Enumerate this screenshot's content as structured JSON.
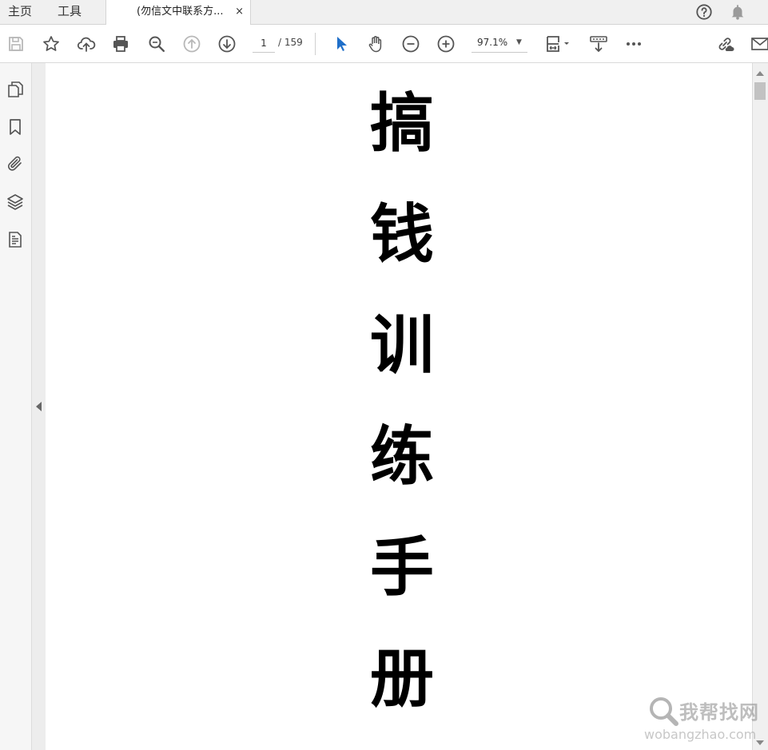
{
  "tabs": {
    "home": "主页",
    "tools": "工具",
    "document_title": "(勿信文中联系方...",
    "close_glyph": "×"
  },
  "toolbar": {
    "icons": [
      "save-icon",
      "star-icon",
      "upload-cloud-icon",
      "print-icon",
      "zoom-search-icon",
      "page-up-icon",
      "page-down-icon",
      "select-arrow-icon",
      "hand-icon",
      "zoom-out-icon",
      "zoom-in-icon",
      "fit-page-icon",
      "read-mode-icon",
      "more-icon",
      "link-share-icon",
      "mail-icon"
    ],
    "page_current": "1",
    "page_total": "/ 159",
    "zoom_value": "97.1%"
  },
  "sidebar": {
    "icons": [
      "pages-icon",
      "bookmark-icon",
      "attachment-icon",
      "layers-icon",
      "document-properties-icon"
    ]
  },
  "document": {
    "characters": [
      "搞",
      "钱",
      "训",
      "练",
      "手",
      "册"
    ]
  },
  "watermark": {
    "cn": "我帮找网",
    "en": "wobangzhao.com"
  },
  "colors": {
    "accent": "#1f6fc9",
    "toolbar_icon": "#555555",
    "disabled_icon": "#b8b8b8"
  }
}
